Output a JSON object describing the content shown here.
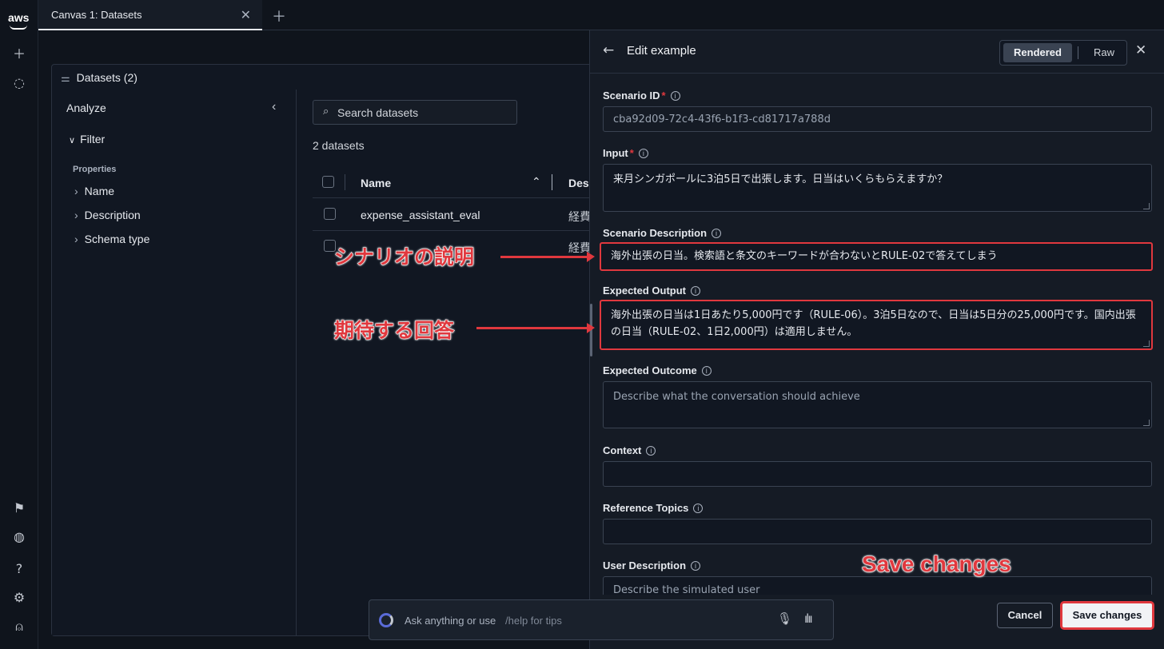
{
  "rail": {
    "brand": "aws",
    "icons": [
      "plus-icon",
      "chat-icon",
      "megaphone-icon",
      "planet-icon",
      "help-icon",
      "settings-icon",
      "user-icon"
    ]
  },
  "tabs": [
    {
      "label": "Canvas 1: Datasets",
      "active": true
    }
  ],
  "datasets_panel": {
    "title": "Datasets (2)",
    "analyze_label": "Analyze",
    "filter_label": "Filter",
    "properties_label": "Properties",
    "properties": [
      "Name",
      "Description",
      "Schema type"
    ],
    "search_placeholder": "Search datasets",
    "count_text": "2 datasets",
    "columns": [
      "Name",
      "Descr"
    ],
    "rows": [
      {
        "name": "expense_assistant_eval",
        "description": "経費"
      },
      {
        "name": "",
        "description": "経費"
      }
    ]
  },
  "drawer": {
    "title": "Edit example",
    "view_modes": [
      "Rendered",
      "Raw"
    ],
    "active_view": "Rendered",
    "fields": {
      "scenario_id": {
        "label": "Scenario ID",
        "value": "cba92d09-72c4-43f6-b1f3-cd81717a788d"
      },
      "input": {
        "label": "Input",
        "value": "来月シンガポールに3泊5日で出張します。日当はいくらもらえますか？"
      },
      "scenario_description": {
        "label": "Scenario Description",
        "value": "海外出張の日当。検索語と条文のキーワードが合わないとRULE-02で答えてしまう"
      },
      "expected_output": {
        "label": "Expected Output",
        "value": "海外出張の日当は1日あたり5,000円です（RULE-06）。3泊5日なので、日当は5日分の25,000円です。国内出張の日当（RULE-02、1日2,000円）は適用しません。"
      },
      "expected_outcome": {
        "label": "Expected Outcome",
        "placeholder": "Describe what the conversation should achieve"
      },
      "context": {
        "label": "Context",
        "value": ""
      },
      "reference_topics": {
        "label": "Reference Topics",
        "value": ""
      },
      "user_description": {
        "label": "User Description",
        "placeholder": "Describe the simulated user"
      }
    },
    "cancel_label": "Cancel",
    "save_label": "Save changes"
  },
  "chat": {
    "placeholder": "Ask anything or use",
    "hint": "/help for tips"
  },
  "annotations": {
    "scenario_description": "シナリオの説明",
    "expected_output": "期待する回答",
    "save_changes": "Save changes"
  },
  "colors": {
    "background": "#0f141c",
    "drawer": "#151b25",
    "highlight": "#e0383e",
    "primary_button": "#f1f3f6"
  }
}
